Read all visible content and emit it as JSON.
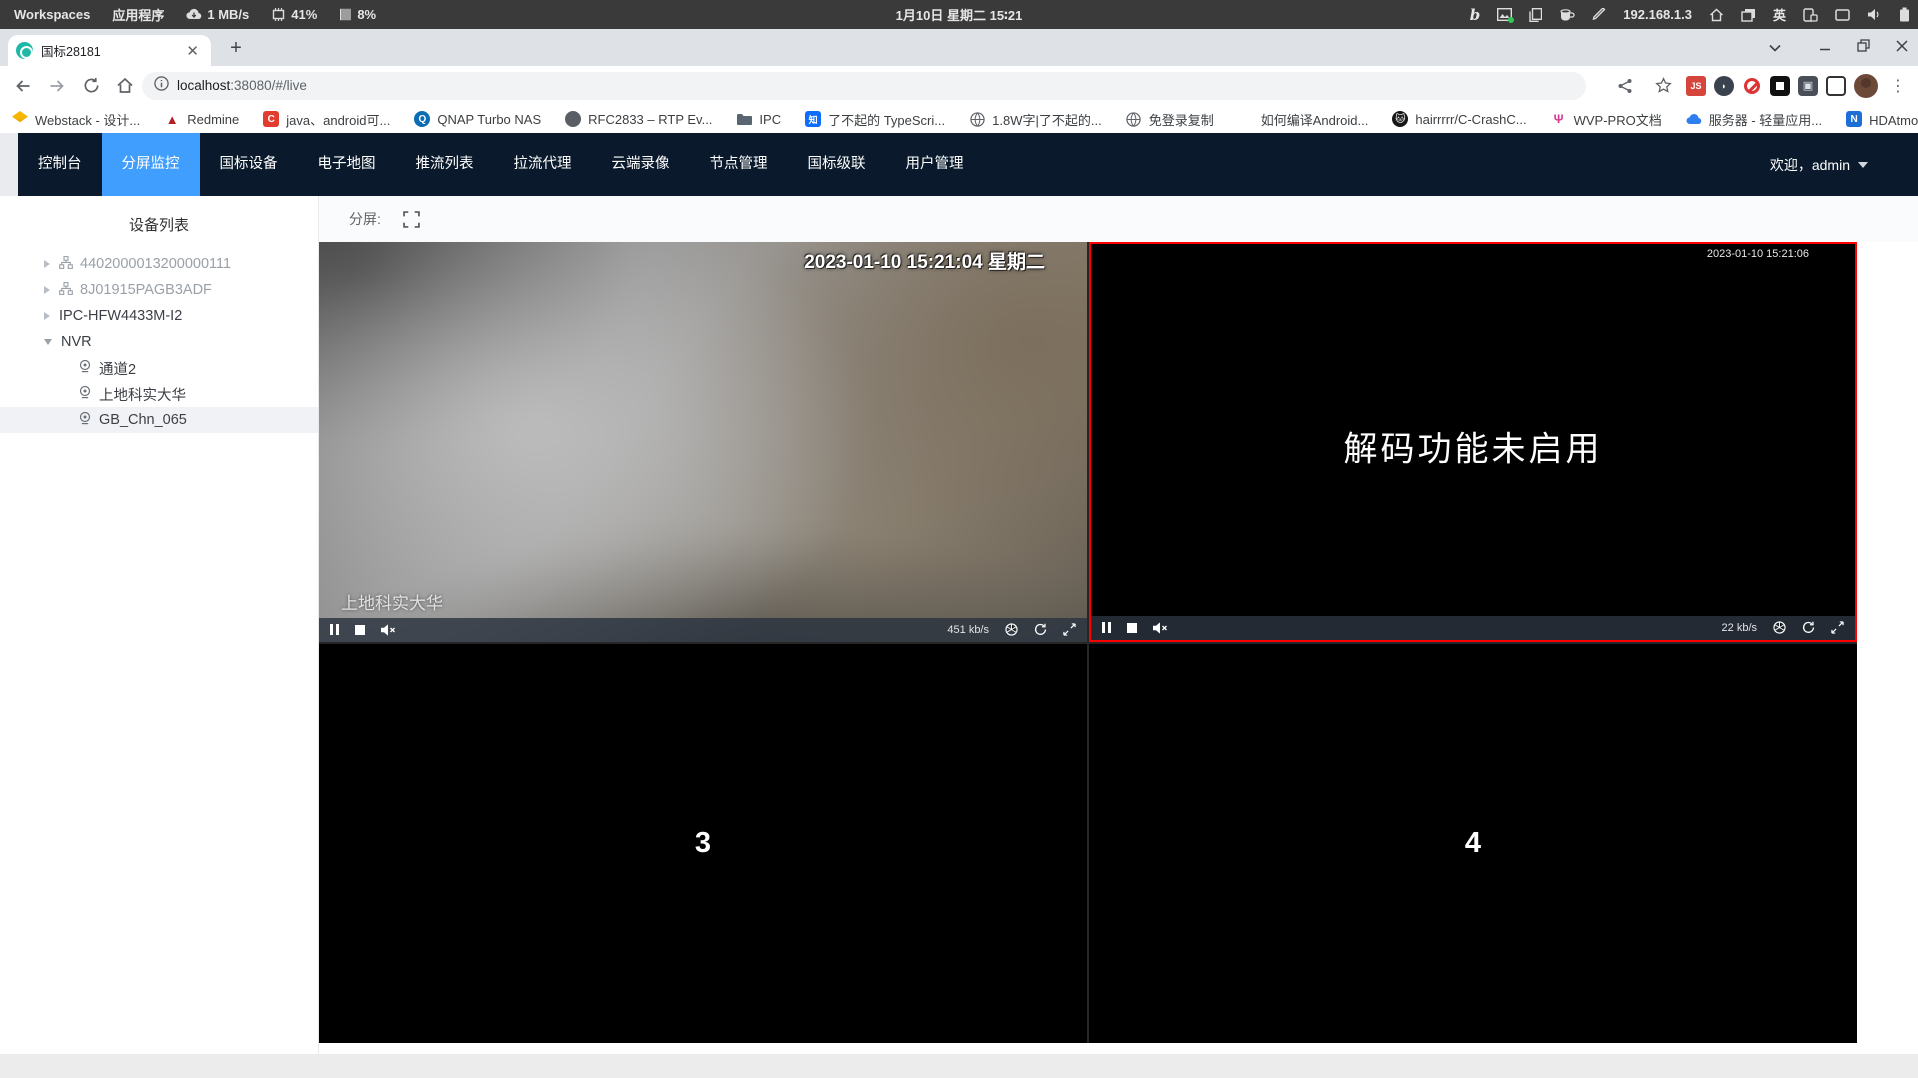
{
  "colors": {
    "accent": "#409eff",
    "nav_bg": "#0a1a2c",
    "cell_selected_border": "#ff0000",
    "tab_favicon": "#1db8a6"
  },
  "system_bar": {
    "workspaces": "Workspaces",
    "applications": "应用程序",
    "network_speed": "1 MB/s",
    "cpu": "41%",
    "memory": "8%",
    "clock": "1月10日 星期二 15∶21",
    "ip": "192.168.1.3",
    "language": "英"
  },
  "browser": {
    "tab_title": "国标28181",
    "url_host": "localhost",
    "url_rest": ":38080/#/live",
    "overflow_chevron": "»",
    "bookmarks": [
      {
        "label": "Webstack - 设计..."
      },
      {
        "label": "Redmine"
      },
      {
        "label": "java、android可..."
      },
      {
        "label": "QNAP Turbo NAS"
      },
      {
        "label": "RFC2833 – RTP Ev..."
      },
      {
        "label": "IPC"
      },
      {
        "label": "了不起的 TypeScri..."
      },
      {
        "label": "1.8W字|了不起的..."
      },
      {
        "label": "免登录复制"
      },
      {
        "label": "如何编译Android..."
      },
      {
        "label": "hairrrrr/C-CrashC..."
      },
      {
        "label": "WVP-PRO文档"
      },
      {
        "label": "服务器 - 轻量应用..."
      },
      {
        "label": "HDAtmos :: 种子 *..."
      }
    ]
  },
  "nav": {
    "items": [
      "控制台",
      "分屏监控",
      "国标设备",
      "电子地图",
      "推流列表",
      "拉流代理",
      "云端录像",
      "节点管理",
      "国标级联",
      "用户管理"
    ],
    "active": "分屏监控",
    "welcome": "欢迎，admin"
  },
  "sidebar": {
    "title": "设备列表",
    "tree": [
      {
        "label": "4402000013200000111"
      },
      {
        "label": "8J01915PAGB3ADF"
      },
      {
        "label": "IPC-HFW4433M-I2"
      },
      {
        "label": "NVR"
      },
      {
        "label": "通道2"
      },
      {
        "label": "上地科实大华"
      },
      {
        "label": "GB_Chn_065"
      }
    ]
  },
  "main": {
    "split_label": "分屏:",
    "cells": [
      {
        "name": "上地科实大华",
        "timestamp": "2023-01-10 15:21:04 星期二",
        "bitrate": "451 kb/s"
      },
      {
        "message": "解码功能未启用",
        "timestamp": "2023-01-10 15:21:06",
        "bitrate": "22 kb/s"
      },
      {
        "placeholder": "3"
      },
      {
        "placeholder": "4"
      }
    ]
  }
}
